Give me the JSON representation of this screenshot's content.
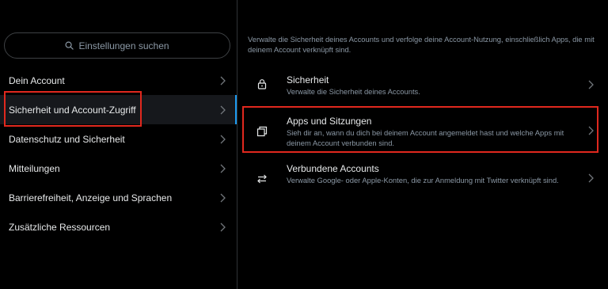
{
  "search": {
    "placeholder": "Einstellungen suchen"
  },
  "nav": {
    "items": [
      {
        "label": "Dein Account"
      },
      {
        "label": "Sicherheit und Account-Zugriff"
      },
      {
        "label": "Datenschutz und Sicherheit"
      },
      {
        "label": "Mitteilungen"
      },
      {
        "label": "Barrierefreiheit, Anzeige und Sprachen"
      },
      {
        "label": "Zusätzliche Ressourcen"
      }
    ],
    "active_index": 1
  },
  "main": {
    "intro": "Verwalte die Sicherheit deines Accounts und verfolge deine Account-Nutzung, einschließlich Apps, die mit deinem Account verknüpft sind.",
    "options": [
      {
        "title": "Sicherheit",
        "desc": "Verwalte die Sicherheit deines Accounts.",
        "icon": "lock-icon"
      },
      {
        "title": "Apps und Sitzungen",
        "desc": "Sieh dir an, wann du dich bei deinem Account angemeldet hast und welche Apps mit deinem Account verbunden sind.",
        "icon": "copy-icon"
      },
      {
        "title": "Verbundene Accounts",
        "desc": "Verwalte Google- oder Apple-Konten, die zur Anmeldung mit Twitter verknüpft sind.",
        "icon": "swap-arrows-icon"
      }
    ]
  },
  "colors": {
    "background": "#000000",
    "accent": "#1d9bf0",
    "highlight": "#e0281e",
    "secondary_text": "#8b98a5"
  }
}
